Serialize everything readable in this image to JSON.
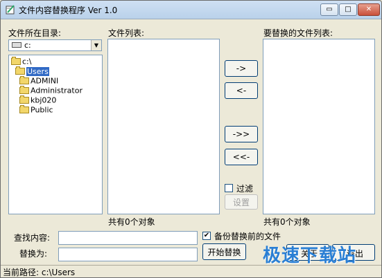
{
  "window": {
    "title": "文件内容替换程序 Ver 1.0",
    "minimize_glyph": "▭",
    "maximize_glyph": "□",
    "close_glyph": "✕"
  },
  "left": {
    "label": "文件所在目录:",
    "drive_value": "c:",
    "tree": [
      {
        "label": "c:\\",
        "indent": 0,
        "selected": false
      },
      {
        "label": "Users",
        "indent": 1,
        "selected": true
      },
      {
        "label": "ADMINI",
        "indent": 2,
        "selected": false
      },
      {
        "label": "Administrator",
        "indent": 2,
        "selected": false
      },
      {
        "label": "kbj020",
        "indent": 2,
        "selected": false
      },
      {
        "label": "Public",
        "indent": 2,
        "selected": false
      }
    ]
  },
  "middle": {
    "label": "文件列表:",
    "count_text": "共有0个对象"
  },
  "right": {
    "label": "要替换的文件列表:",
    "count_text": "共有0个对象"
  },
  "transfer_buttons": {
    "add": "->",
    "remove": "<-",
    "add_all": "->>",
    "remove_all": "<<-"
  },
  "filter": {
    "label": "过滤",
    "settings": "设置",
    "checked": false
  },
  "search": {
    "find_label": "查找内容:",
    "replace_label": "替换为:",
    "find_value": "",
    "replace_value": ""
  },
  "backup": {
    "label": "备份替换前的文件",
    "checked": true,
    "check_glyph": "✔"
  },
  "actions": {
    "start": "开始替换",
    "about": "关于",
    "exit": "退出"
  },
  "status": {
    "text": "当前路径: c:\\Users"
  },
  "watermark": {
    "text": "极速下载站"
  }
}
